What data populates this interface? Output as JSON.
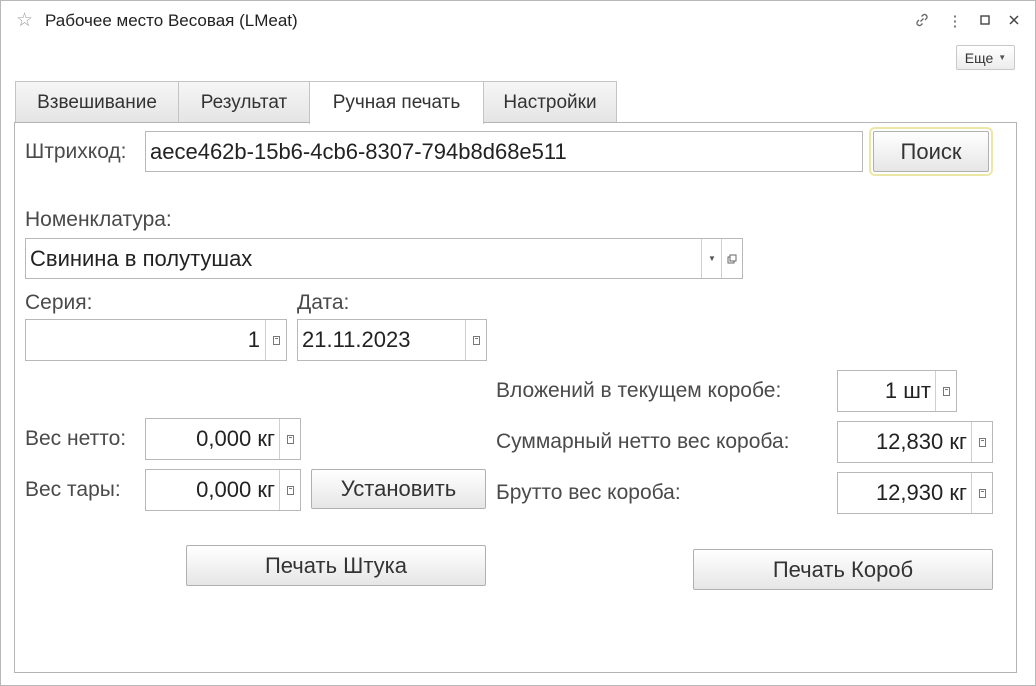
{
  "window": {
    "title": "Рабочее место Весовая (LMeat)",
    "more_label": "Еще"
  },
  "tabs": [
    {
      "label": "Взвешивание"
    },
    {
      "label": "Результат"
    },
    {
      "label": "Ручная печать"
    },
    {
      "label": "Настройки"
    }
  ],
  "barcode": {
    "label": "Штрихкод:",
    "value": "aece462b-15b6-4cb6-8307-794b8d68e511",
    "search_label": "Поиск"
  },
  "nomenclature": {
    "label": "Номенклатура:",
    "value": "Свинина в полутушах"
  },
  "series": {
    "label": "Серия:",
    "value": "1"
  },
  "date": {
    "label": "Дата:",
    "value": "21.11.2023"
  },
  "net_weight": {
    "label": "Вес нетто:",
    "value": "0,000 кг"
  },
  "tare_weight": {
    "label": "Вес тары:",
    "value": "0,000 кг",
    "set_label": "Установить"
  },
  "box": {
    "count_label": "Вложений в текущем коробе:",
    "count_value": "1 шт",
    "net_label": "Суммарный нетто вес короба:",
    "net_value": "12,830 кг",
    "gross_label": "Брутто вес короба:",
    "gross_value": "12,930 кг"
  },
  "actions": {
    "print_item": "Печать Штука",
    "print_box": "Печать Короб"
  }
}
